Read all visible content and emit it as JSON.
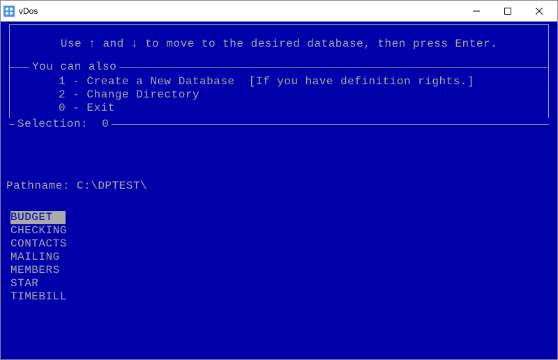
{
  "window": {
    "title": "vDos"
  },
  "instruction": "Use ↑ and ↓ to move to the desired database, then press Enter.",
  "inner_legend": "You can also",
  "menu": [
    "1 - Create a New Database  [If you have definition rights.]",
    "2 - Change Directory",
    "0 - Exit"
  ],
  "selection_label": "Selection:  ",
  "selection_value": "0",
  "pathname_label": "Pathname: ",
  "pathname_value": "C:\\DPTEST\\",
  "databases": [
    "BUDGET",
    "CHECKING",
    "CONTACTS",
    "MAILING",
    "MEMBERS",
    "STAR",
    "TIMEBILL"
  ],
  "selected_db_index": 0
}
